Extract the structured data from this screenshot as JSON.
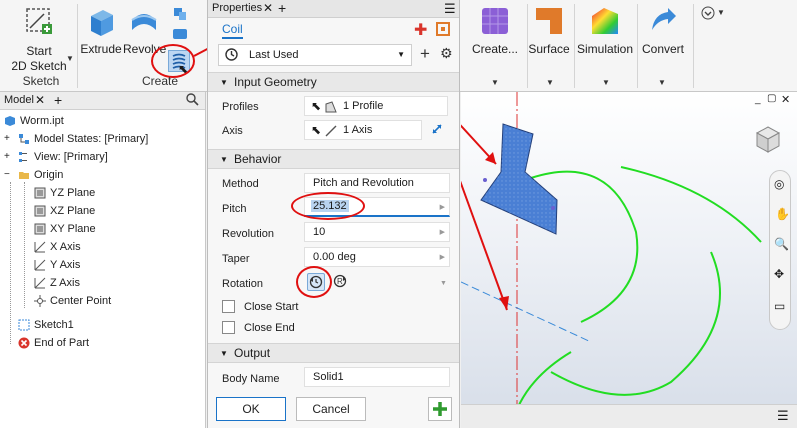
{
  "ribbon": {
    "sketch_btn": {
      "line1": "Start",
      "line2": "2D Sketch"
    },
    "sketch_group": "Sketch",
    "extrude": "Extrude",
    "revolve": "Revolve",
    "create_group": "Create",
    "create_more": "Create...",
    "surface": "Surface",
    "simulation": "Simulation",
    "convert": "Convert"
  },
  "browser": {
    "tab": "Model",
    "items": [
      {
        "label": "Worm.ipt"
      },
      {
        "label": "Model States: [Primary]"
      },
      {
        "label": "View: [Primary]"
      },
      {
        "label": "Origin"
      },
      {
        "label": "YZ Plane"
      },
      {
        "label": "XZ Plane"
      },
      {
        "label": "XY Plane"
      },
      {
        "label": "X Axis"
      },
      {
        "label": "Y Axis"
      },
      {
        "label": "Z Axis"
      },
      {
        "label": "Center Point"
      },
      {
        "label": "Sketch1"
      },
      {
        "label": "End of Part"
      }
    ]
  },
  "properties": {
    "tab": "Properties",
    "feature_tab": "Coil",
    "preset": "Last Used",
    "input_geometry": {
      "title": "Input Geometry",
      "profiles_label": "Profiles",
      "profiles_value": "1 Profile",
      "axis_label": "Axis",
      "axis_value": "1 Axis"
    },
    "behavior": {
      "title": "Behavior",
      "method_label": "Method",
      "method_value": "Pitch and Revolution",
      "pitch_label": "Pitch",
      "pitch_value": "25.132",
      "revolution_label": "Revolution",
      "revolution_value": "10",
      "taper_label": "Taper",
      "taper_value": "0.00 deg",
      "rotation_label": "Rotation",
      "close_start": "Close Start",
      "close_end": "Close End"
    },
    "output": {
      "title": "Output",
      "body_name_label": "Body Name",
      "body_name_value": "Solid1"
    },
    "ok": "OK",
    "cancel": "Cancel"
  },
  "colors": {
    "accent": "#1a73c8",
    "annotation": "#e01010",
    "profile_fill": "#4a7fd4",
    "helix": "#22dd22"
  }
}
